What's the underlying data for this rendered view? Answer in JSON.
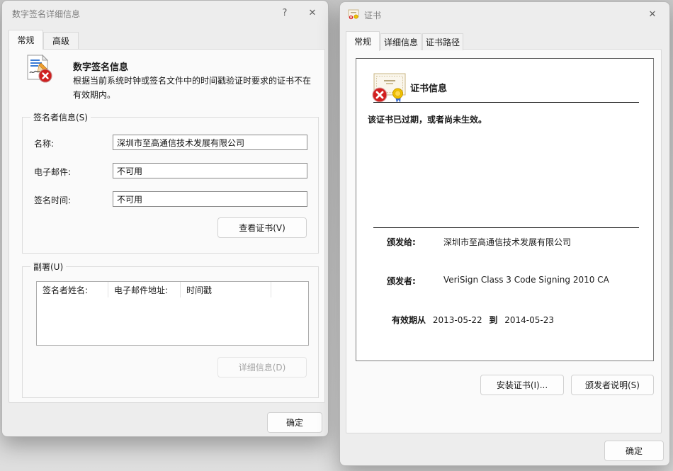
{
  "colors": {
    "badge_red": "#d21f1f",
    "seal_gold": "#f2c200",
    "ribbon_blue": "#3b6fd4",
    "doc_line_blue": "#3a7bd5",
    "dialog_bg": "#ededed",
    "page_bg": "#fafafa"
  },
  "left_dialog": {
    "title": "数字签名详细信息",
    "titlebar": {
      "help_glyph": "?",
      "close_glyph": "✕"
    },
    "tabs": [
      {
        "label": "常规"
      },
      {
        "label": "高级"
      }
    ],
    "header": {
      "title": "数字签名信息",
      "description": "根据当前系统时钟或签名文件中的时间戳验证时要求的证书不在有效期内。"
    },
    "signer_group": {
      "label": "签名者信息(S)",
      "fields": [
        {
          "label": "名称:",
          "value": "深圳市至高通信技术发展有限公司"
        },
        {
          "label": "电子邮件:",
          "value": "不可用"
        },
        {
          "label": "签名时间:",
          "value": "不可用"
        }
      ],
      "view_cert_button": "查看证书(V)"
    },
    "countersign_group": {
      "label": "副署(U)",
      "columns": [
        "签名者姓名:",
        "电子邮件地址:",
        "时间戳"
      ],
      "details_button": "详细信息(D)"
    },
    "ok_button": "确定"
  },
  "right_dialog": {
    "title": "证书",
    "titlebar": {
      "close_glyph": "✕"
    },
    "tabs": [
      {
        "label": "常规"
      },
      {
        "label": "详细信息"
      },
      {
        "label": "证书路径"
      }
    ],
    "cert_info": {
      "heading": "证书信息",
      "status": "该证书已过期，或者尚未生效。",
      "issued_to_label": "颁发给:",
      "issued_to": "深圳市至高通信技术发展有限公司",
      "issued_by_label": "颁发者:",
      "issued_by": "VeriSign Class 3 Code Signing 2010 CA",
      "valid_from_label": "有效期从",
      "valid_from": "2013-05-22",
      "valid_to_label": "到",
      "valid_to": "2014-05-23"
    },
    "install_button": "安装证书(I)...",
    "issuer_statement_button": "颁发者说明(S)",
    "ok_button": "确定"
  }
}
